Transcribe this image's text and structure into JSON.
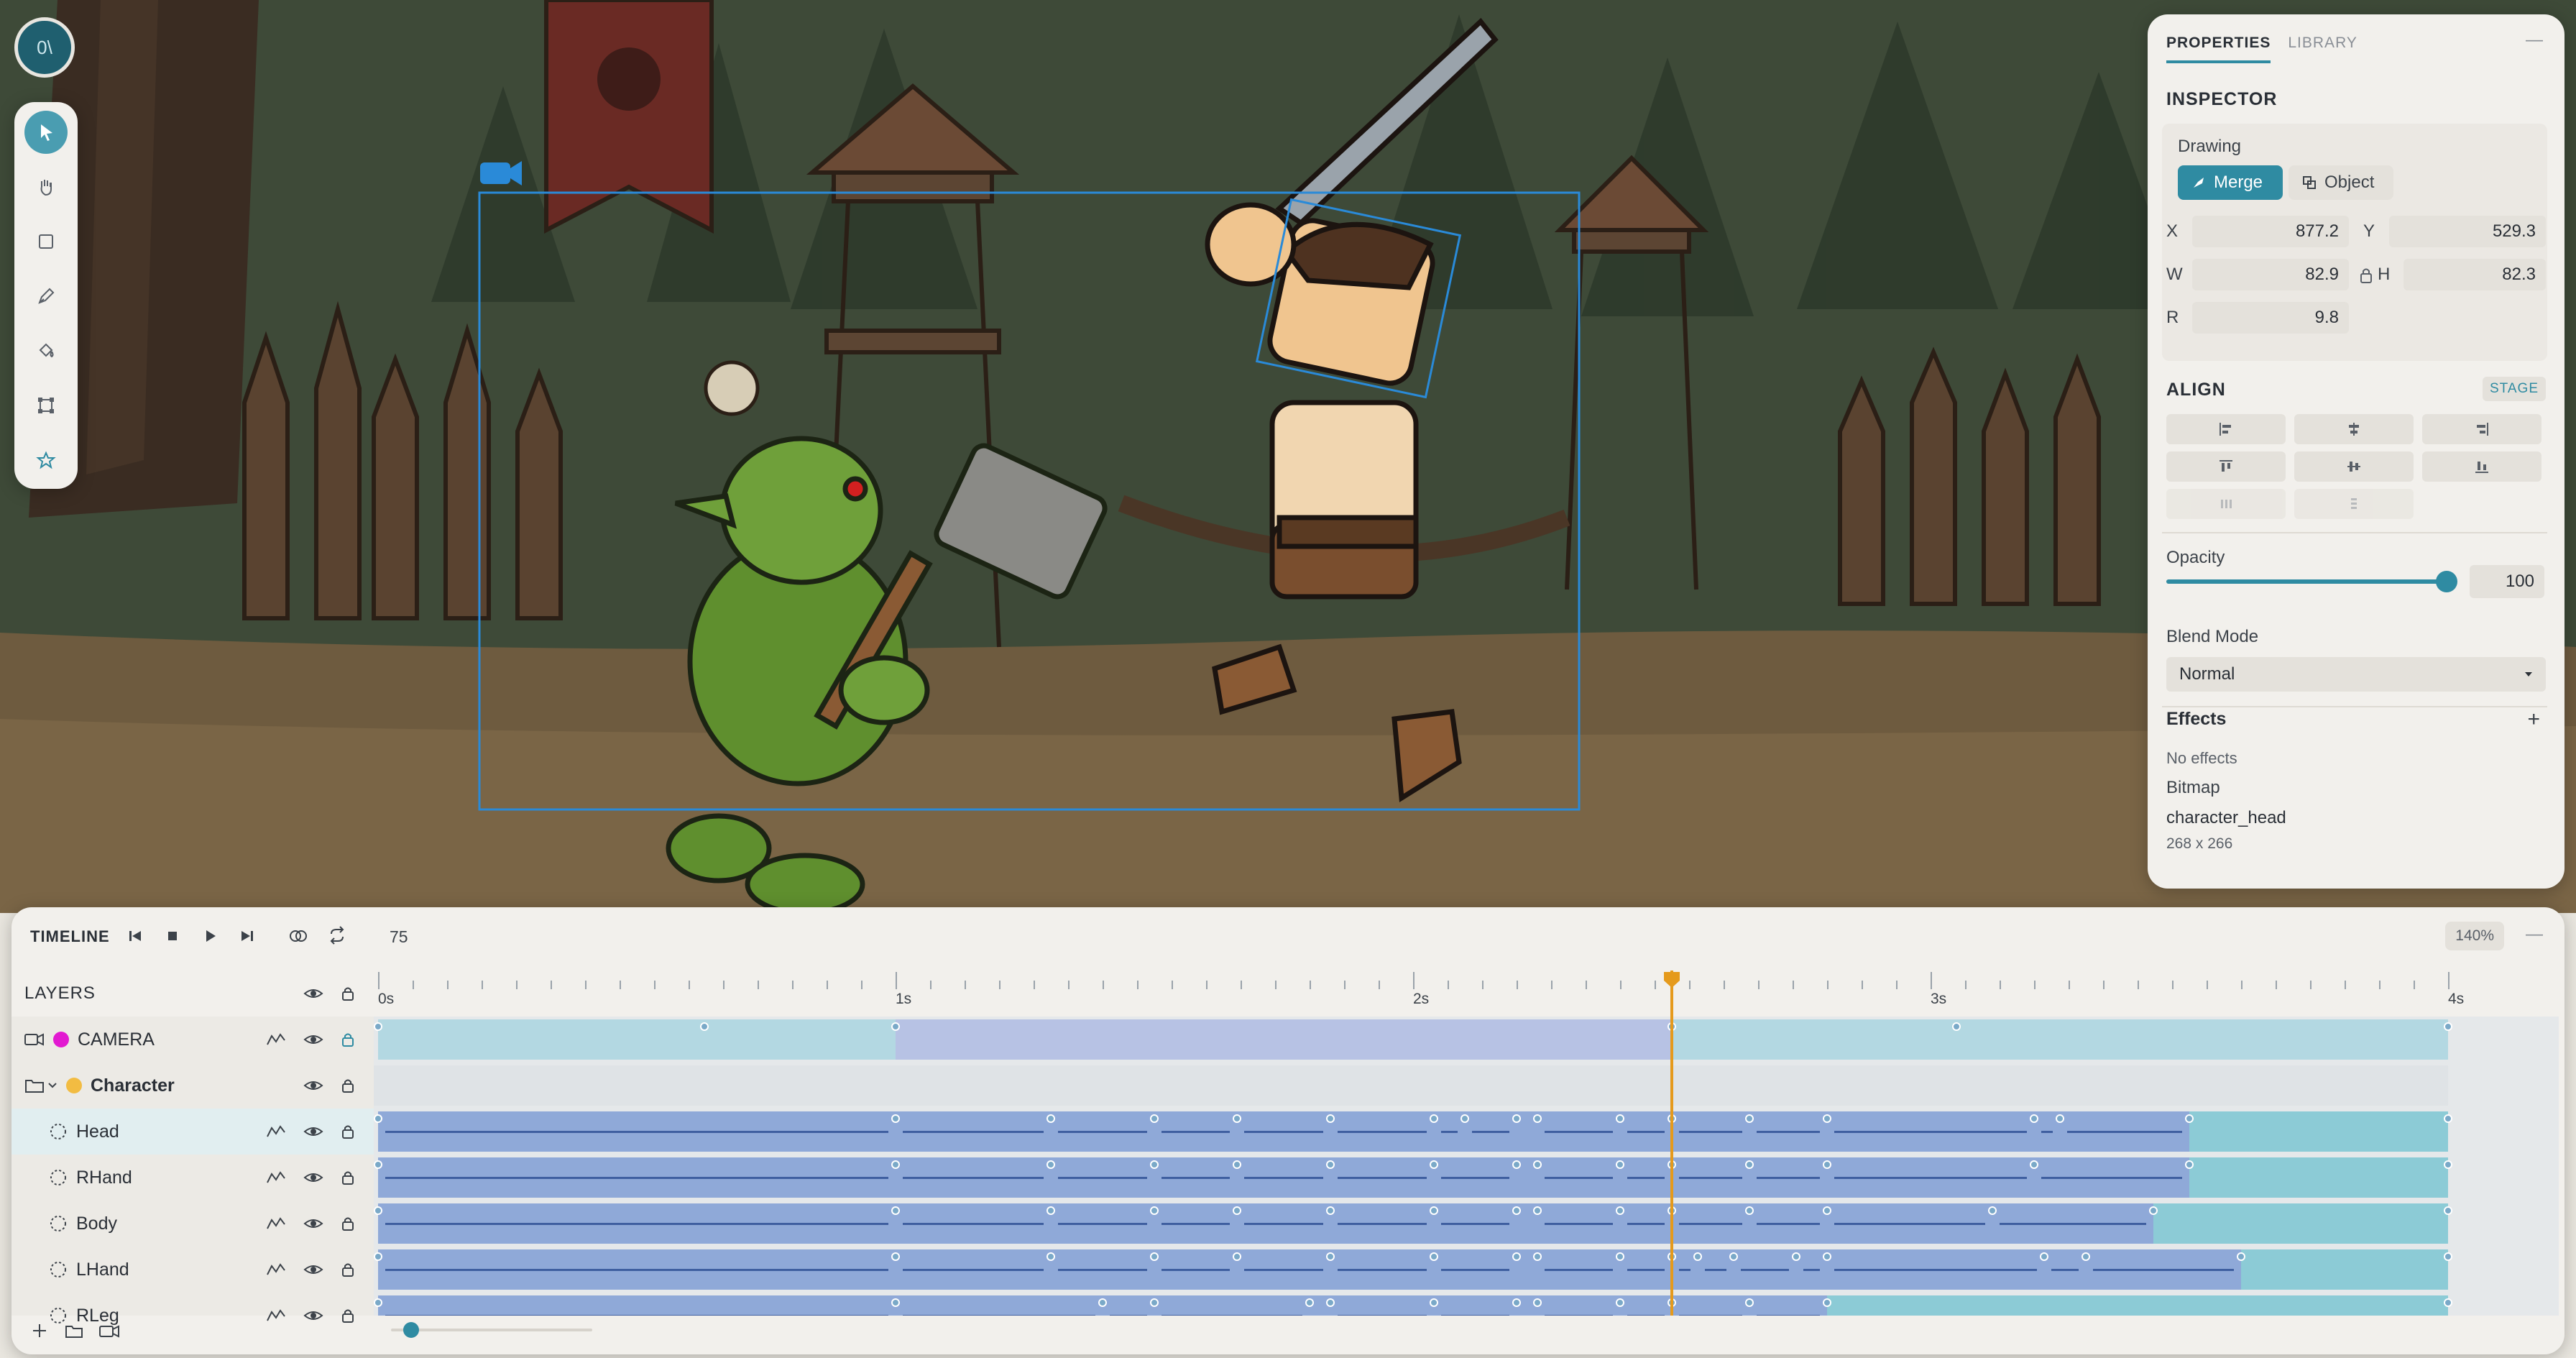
{
  "toolbar": {
    "top_button_label": "0\\",
    "tools": [
      {
        "name": "select-arrow-icon",
        "active": true
      },
      {
        "name": "hand-icon",
        "active": false
      },
      {
        "name": "rectangle-icon",
        "active": false
      },
      {
        "name": "pen-icon",
        "active": false
      },
      {
        "name": "paint-bucket-icon",
        "active": false
      },
      {
        "name": "transform-icon",
        "active": false
      },
      {
        "name": "star-icon",
        "active": false
      }
    ]
  },
  "stage": {
    "camera_icon": "camera-icon"
  },
  "properties": {
    "tabs": [
      "PROPERTIES",
      "LIBRARY"
    ],
    "active_tab": "PROPERTIES",
    "collapse_label": "—",
    "inspector_title": "INSPECTOR",
    "drawing_label": "Drawing",
    "merge_label": "Merge",
    "object_label": "Object",
    "x_label": "X",
    "x_value": "877.2",
    "y_label": "Y",
    "y_value": "529.3",
    "w_label": "W",
    "w_value": "82.9",
    "h_label": "H",
    "h_value": "82.3",
    "r_label": "R",
    "r_value": "9.8",
    "align_title": "ALIGN",
    "stage_label": "STAGE",
    "opacity_label": "Opacity",
    "opacity_value": "100",
    "opacity_fraction": 1.0,
    "blend_label": "Blend Mode",
    "blend_value": "Normal",
    "effects_title": "Effects",
    "effects_add": "+",
    "no_effects": "No effects",
    "bitmap_label": "Bitmap",
    "bitmap_name": "character_head",
    "bitmap_size": "268 x 266",
    "accent": "#2f8ba2"
  },
  "timeline": {
    "title": "TIMELINE",
    "frame": "75",
    "zoom": "140%",
    "collapse_label": "—",
    "layers_title": "LAYERS",
    "time_labels": [
      "0s",
      "1s",
      "2s",
      "3s",
      "4s"
    ],
    "playhead_seconds": 2.5,
    "duration_seconds": 4.0,
    "layers": [
      {
        "name": "CAMERA",
        "type": "camera",
        "color": "#e21ad1",
        "graph": true
      },
      {
        "name": "Character",
        "type": "folder",
        "color": "#f2bc42",
        "graph": false
      },
      {
        "name": "Head",
        "type": "bone",
        "graph": true
      },
      {
        "name": "RHand",
        "type": "bone",
        "graph": true
      },
      {
        "name": "Body",
        "type": "bone",
        "graph": true
      },
      {
        "name": "LHand",
        "type": "bone",
        "graph": true
      },
      {
        "name": "RLeg",
        "type": "bone",
        "graph": true
      }
    ],
    "scrub_fraction": 0.2,
    "track_colors": {
      "tween": "#8fa9d8",
      "hold": "#8ccbd6",
      "camera": "#b3d8e2",
      "empty": "#e5e8ea"
    }
  }
}
